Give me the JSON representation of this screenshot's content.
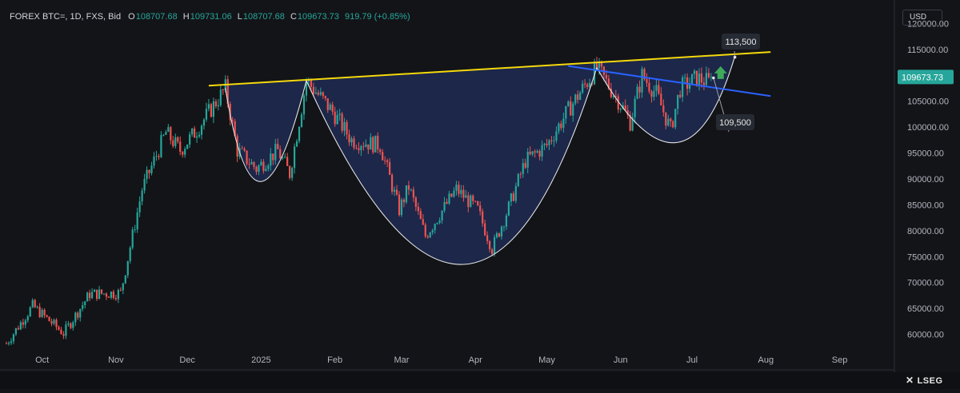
{
  "header": {
    "symbol": "FOREX BTC=, 1D, FXS, Bid",
    "open_label": "O",
    "open_value": "108707.68",
    "high_label": "H",
    "high_value": "109731.06",
    "low_label": "L",
    "low_value": "108707.68",
    "close_label": "C",
    "close_value": "109673.73",
    "change": "919.79 (+0.85%)"
  },
  "currency": "USD",
  "brand": "LSEG",
  "colors": {
    "background": "#131418",
    "up": "#26a69a",
    "down": "#ef5350",
    "resistance_line": "#f5d90a",
    "neckline": "#2962ff",
    "pattern_fill": "#1e2a52",
    "price_badge": "#26a69a",
    "arrow": "#3fa95a"
  },
  "chart_data": {
    "type": "candlestick",
    "instrument": "FOREX BTC=, 1D, FXS, Bid",
    "ylim": [
      57000,
      123000
    ],
    "y_ticks": [
      60000,
      65000,
      70000,
      75000,
      80000,
      85000,
      90000,
      95000,
      100000,
      105000,
      110000,
      115000,
      120000
    ],
    "y_tick_labels": [
      "60000.00",
      "65000.00",
      "70000.00",
      "75000.00",
      "80000.00",
      "85000.00",
      "90000.00",
      "95000.00",
      "100000.00",
      "105000.00",
      "110000.00",
      "115000.00",
      "120000.00"
    ],
    "x_tick_labels": [
      "Oct",
      "Nov",
      "Dec",
      "2025",
      "Feb",
      "Mar",
      "Apr",
      "May",
      "Jun",
      "Jul",
      "Aug",
      "Sep"
    ],
    "x_tick_dates": [
      "2024-10-01",
      "2024-11-01",
      "2024-12-01",
      "2025-01-01",
      "2025-02-01",
      "2025-03-01",
      "2025-04-01",
      "2025-05-01",
      "2025-06-01",
      "2025-07-01",
      "2025-08-01",
      "2025-09-01"
    ],
    "x_range": [
      "2024-09-16",
      "2025-09-24"
    ],
    "last_price": 109673.73,
    "last_price_label": "109673.73",
    "price_path": [
      [
        "2024-09-16",
        58200
      ],
      [
        "2024-09-27",
        65500
      ],
      [
        "2024-10-10",
        60200
      ],
      [
        "2024-10-21",
        67800
      ],
      [
        "2024-11-03",
        68000
      ],
      [
        "2024-11-12",
        88000
      ],
      [
        "2024-11-22",
        99000
      ],
      [
        "2024-11-28",
        95500
      ],
      [
        "2024-12-05",
        99500
      ],
      [
        "2024-12-17",
        107500
      ],
      [
        "2024-12-22",
        95500
      ],
      [
        "2024-12-30",
        92000
      ],
      [
        "2025-01-08",
        95500
      ],
      [
        "2025-01-13",
        91000
      ],
      [
        "2025-01-20",
        109000
      ],
      [
        "2025-01-31",
        103000
      ],
      [
        "2025-02-08",
        97500
      ],
      [
        "2025-02-20",
        96500
      ],
      [
        "2025-02-28",
        84000
      ],
      [
        "2025-03-04",
        88500
      ],
      [
        "2025-03-11",
        79000
      ],
      [
        "2025-03-24",
        88000
      ],
      [
        "2025-04-02",
        84000
      ],
      [
        "2025-04-08",
        76500
      ],
      [
        "2025-04-15",
        84500
      ],
      [
        "2025-04-22",
        93500
      ],
      [
        "2025-05-01",
        96500
      ],
      [
        "2025-05-11",
        104000
      ],
      [
        "2025-05-22",
        111500
      ],
      [
        "2025-06-01",
        104500
      ],
      [
        "2025-06-05",
        101000
      ],
      [
        "2025-06-10",
        110000
      ],
      [
        "2025-06-16",
        106500
      ],
      [
        "2025-06-22",
        99500
      ],
      [
        "2025-06-26",
        107500
      ],
      [
        "2025-07-03",
        109500
      ],
      [
        "2025-07-08",
        108700
      ],
      [
        "2025-07-09",
        109673.73
      ]
    ],
    "annotations": {
      "resistance_line": {
        "from": [
          "2024-12-10",
          108000
        ],
        "to": [
          "2025-08-03",
          114500
        ]
      },
      "neckline": {
        "from": [
          "2025-05-10",
          111800
        ],
        "to": [
          "2025-08-03",
          106000
        ]
      },
      "left_shoulder": {
        "left": [
          "2024-12-17",
          107500
        ],
        "bottom": [
          "2025-01-01",
          89500
        ],
        "right": [
          "2025-01-20",
          109000
        ]
      },
      "head": {
        "left": [
          "2025-01-20",
          109000
        ],
        "bottom": [
          "2025-03-27",
          73500
        ],
        "right": [
          "2025-05-22",
          111500
        ]
      },
      "right_shoulder": {
        "left": [
          "2025-05-22",
          111500
        ],
        "bottom": [
          "2025-06-24",
          97000
        ],
        "right": [
          "2025-07-19",
          113700
        ]
      },
      "labels": [
        {
          "text": "113,500",
          "date": "2025-07-19",
          "value": 113500
        },
        {
          "text": "109,500",
          "date": "2025-07-10",
          "value": 109500
        }
      ],
      "breakout_arrow": "up"
    }
  }
}
